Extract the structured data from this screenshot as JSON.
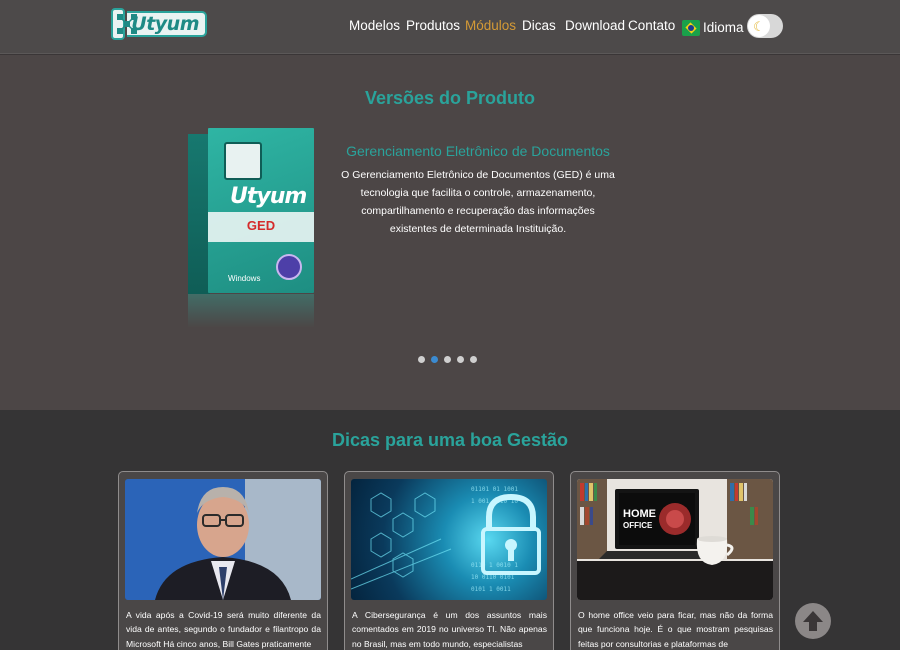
{
  "header": {
    "logo_text": "Utyum",
    "nav": [
      "Modelos",
      "Produtos",
      "Módulos",
      "Dicas",
      "Download",
      "Contato"
    ],
    "active_nav": "Módulos",
    "language_label": "Idioma",
    "theme_toggle_icon": "moon-icon"
  },
  "versions": {
    "title": "Versões do Produto",
    "product": {
      "brand": "Utyum",
      "badge": "GED",
      "platform": "Windows"
    },
    "subtitle": "Gerenciamento Eletrônico de Documentos",
    "description": "O Gerenciamento Eletrônico de Documentos (GED) é uma tecnologia que facilita o controle, armazenamento, compartilhamento e recuperação das informações existentes de determinada Instituição.",
    "carousel": {
      "count": 5,
      "active_index": 1
    }
  },
  "tips": {
    "title": "Dicas para uma boa Gestão",
    "cards": [
      {
        "image_icon": "person-photo",
        "overlay": "",
        "text": "A vida após a Covid-19 será muito diferente da vida de antes, segundo o fundador e filantropo da Microsoft Há cinco anos, Bill Gates praticamente"
      },
      {
        "image_icon": "padlock-icon",
        "overlay": "",
        "text": "A Cibersegurança é um dos assuntos mais comentados em 2019 no universo TI. Não apenas no Brasil, mas em todo mundo, especialistas"
      },
      {
        "image_icon": "laptop-photo",
        "overlay": "HOME OFFICE",
        "text": "O home office veio para ficar, mas não da forma que funciona hoje. É o que mostram pesquisas feitas por consultorias e plataformas de"
      }
    ]
  },
  "scroll_top_icon": "arrow-up-icon"
}
